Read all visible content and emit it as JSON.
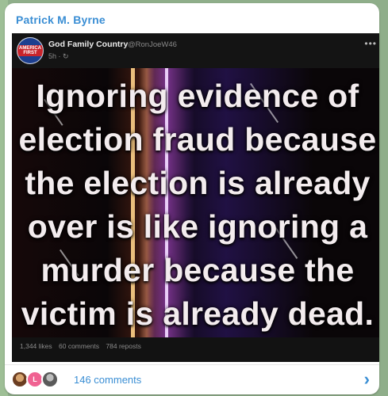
{
  "channel": {
    "name": "Patrick M. Byrne"
  },
  "post": {
    "avatar_text": "AMERICA FIRST",
    "author": "God Family Country",
    "handle": "@RonJoeW46",
    "time": "5h · ↻",
    "menu": "•••",
    "meme_lines": [
      "Ignoring evidence of",
      "election fraud because",
      "the election is already",
      "over is like ignoring a",
      "murder because the",
      "victim is already dead."
    ],
    "likes": "1,344 likes",
    "comments_count": "60 comments",
    "reposts": "784 reposts"
  },
  "footer": {
    "avatar2_letter": "L",
    "comments_label": "146 comments",
    "chevron": "›"
  },
  "colors": {
    "link": "#3a8ed4",
    "post_bg": "#121212"
  }
}
